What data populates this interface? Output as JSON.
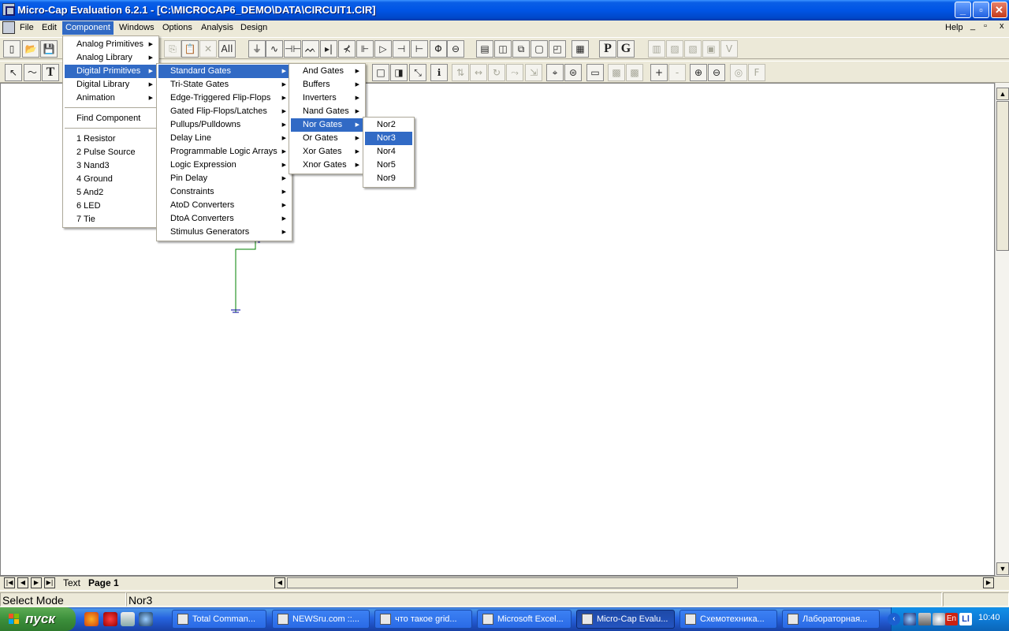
{
  "window": {
    "title": "Micro-Cap Evaluation 6.2.1 - [C:\\MICROCAP6_DEMO\\DATA\\CIRCUIT1.CIR]",
    "minimize": "_",
    "maximize": "▫",
    "close": "✕"
  },
  "menubar": {
    "items": [
      "File",
      "Edit",
      "Component",
      "Windows",
      "Options",
      "Analysis",
      "Design"
    ],
    "active": "Component",
    "help": "Help",
    "mdi_controls": [
      "_",
      "▫",
      "x"
    ]
  },
  "menus": {
    "component": [
      "Analog Primitives",
      "Analog Library",
      "Digital Primitives",
      "Digital Library",
      "Animation",
      "Find Component",
      "1 Resistor",
      "2 Pulse Source",
      "3 Nand3",
      "4 Ground",
      "5 And2",
      "6 LED",
      "7 Tie"
    ],
    "digital_primitives": [
      "Standard Gates",
      "Tri-State Gates",
      "Edge-Triggered Flip-Flops",
      "Gated Flip-Flops/Latches",
      "Pullups/Pulldowns",
      "Delay Line",
      "Programmable Logic Arrays",
      "Logic Expression",
      "Pin Delay",
      "Constraints",
      "AtoD Converters",
      "DtoA Converters",
      "Stimulus Generators"
    ],
    "standard_gates": [
      "And Gates",
      "Buffers",
      "Inverters",
      "Nand Gates",
      "Nor Gates",
      "Or Gates",
      "Xor Gates",
      "Xnor Gates"
    ],
    "nor_gates": [
      "Nor2",
      "Nor3",
      "Nor4",
      "Nor5",
      "Nor9"
    ],
    "selected": {
      "component": "Digital Primitives",
      "digital_primitives": "Standard Gates",
      "standard_gates": "Nor Gates",
      "nor_gates": "Nor3"
    }
  },
  "toolbar1": {
    "buttons": [
      {
        "name": "new-file",
        "glyph": "▯"
      },
      {
        "name": "open-folder",
        "glyph": "📂"
      },
      {
        "name": "save",
        "glyph": "💾"
      },
      {
        "name": "copy",
        "glyph": "⎘"
      },
      {
        "name": "paste",
        "glyph": "📋"
      },
      {
        "name": "delete",
        "glyph": "✕"
      },
      {
        "name": "select-all",
        "glyph": "All"
      },
      {
        "name": "ground",
        "glyph": "⏚"
      },
      {
        "name": "resistor",
        "glyph": "∿"
      },
      {
        "name": "capacitor",
        "glyph": "⊣⊢"
      },
      {
        "name": "inductor",
        "glyph": "ᨓ"
      },
      {
        "name": "diode",
        "glyph": "▸|"
      },
      {
        "name": "npn",
        "glyph": "⊀"
      },
      {
        "name": "nmos",
        "glyph": "⊩"
      },
      {
        "name": "opamp",
        "glyph": "▷"
      },
      {
        "name": "battery",
        "glyph": "⊣"
      },
      {
        "name": "source",
        "glyph": "⊢"
      },
      {
        "name": "current-source",
        "glyph": "Φ"
      },
      {
        "name": "voltage-source",
        "glyph": "⊖"
      },
      {
        "name": "tile-horizontal",
        "glyph": "▤"
      },
      {
        "name": "tile-vertical",
        "glyph": "◫"
      },
      {
        "name": "cascade",
        "glyph": "⧉"
      },
      {
        "name": "maximize-window",
        "glyph": "▢"
      },
      {
        "name": "restore-window",
        "glyph": "◰"
      },
      {
        "name": "calculator",
        "glyph": "▦"
      },
      {
        "name": "p-button",
        "glyph": "P"
      },
      {
        "name": "g-button",
        "glyph": "G"
      },
      {
        "name": "tool-a",
        "glyph": "▥"
      },
      {
        "name": "tool-b",
        "glyph": "▨"
      },
      {
        "name": "tool-c",
        "glyph": "▧"
      },
      {
        "name": "tool-d",
        "glyph": "▣"
      },
      {
        "name": "tool-e",
        "glyph": "V"
      }
    ]
  },
  "toolbar2": {
    "buttons": [
      {
        "name": "select-mode",
        "glyph": "↖"
      },
      {
        "name": "wire-mode",
        "glyph": "〜"
      },
      {
        "name": "text-mode",
        "glyph": "T"
      },
      {
        "name": "rect-mode",
        "glyph": "□"
      },
      {
        "name": "box-mode",
        "glyph": "◨"
      },
      {
        "name": "flag",
        "glyph": "⤡"
      },
      {
        "name": "info",
        "glyph": "ℹ"
      },
      {
        "name": "mirror",
        "glyph": "⇅"
      },
      {
        "name": "flip",
        "glyph": "↔"
      },
      {
        "name": "rotate",
        "glyph": "↻"
      },
      {
        "name": "step",
        "glyph": "⤳"
      },
      {
        "name": "scale",
        "glyph": "⇲"
      },
      {
        "name": "find",
        "glyph": "⌖"
      },
      {
        "name": "binoculars",
        "glyph": "⊜"
      },
      {
        "name": "display",
        "glyph": "▭"
      },
      {
        "name": "layer-a",
        "glyph": "▩"
      },
      {
        "name": "layer-b",
        "glyph": "▩"
      },
      {
        "name": "add-page",
        "glyph": "+"
      },
      {
        "name": "remove-page",
        "glyph": "-"
      },
      {
        "name": "zoom-in",
        "glyph": "⊕"
      },
      {
        "name": "zoom-out",
        "glyph": "⊖"
      },
      {
        "name": "globe",
        "glyph": "◎"
      },
      {
        "name": "font",
        "glyph": "F"
      }
    ]
  },
  "tabs": {
    "text": "Text",
    "page1": "Page 1"
  },
  "status": {
    "mode": "Select Mode",
    "item": "Nor3"
  },
  "taskbar": {
    "start": "пуск",
    "tasks": [
      "Total Comman...",
      "NEWSru.com ::...",
      "что такое grid...",
      "Microsoft Excel...",
      "Micro-Cap Evalu...",
      "Схемотехника...",
      "Лабораторная..."
    ],
    "active_task": "Micro-Cap Evalu...",
    "tray": [
      "En",
      "Ll"
    ],
    "time": "10:40"
  }
}
